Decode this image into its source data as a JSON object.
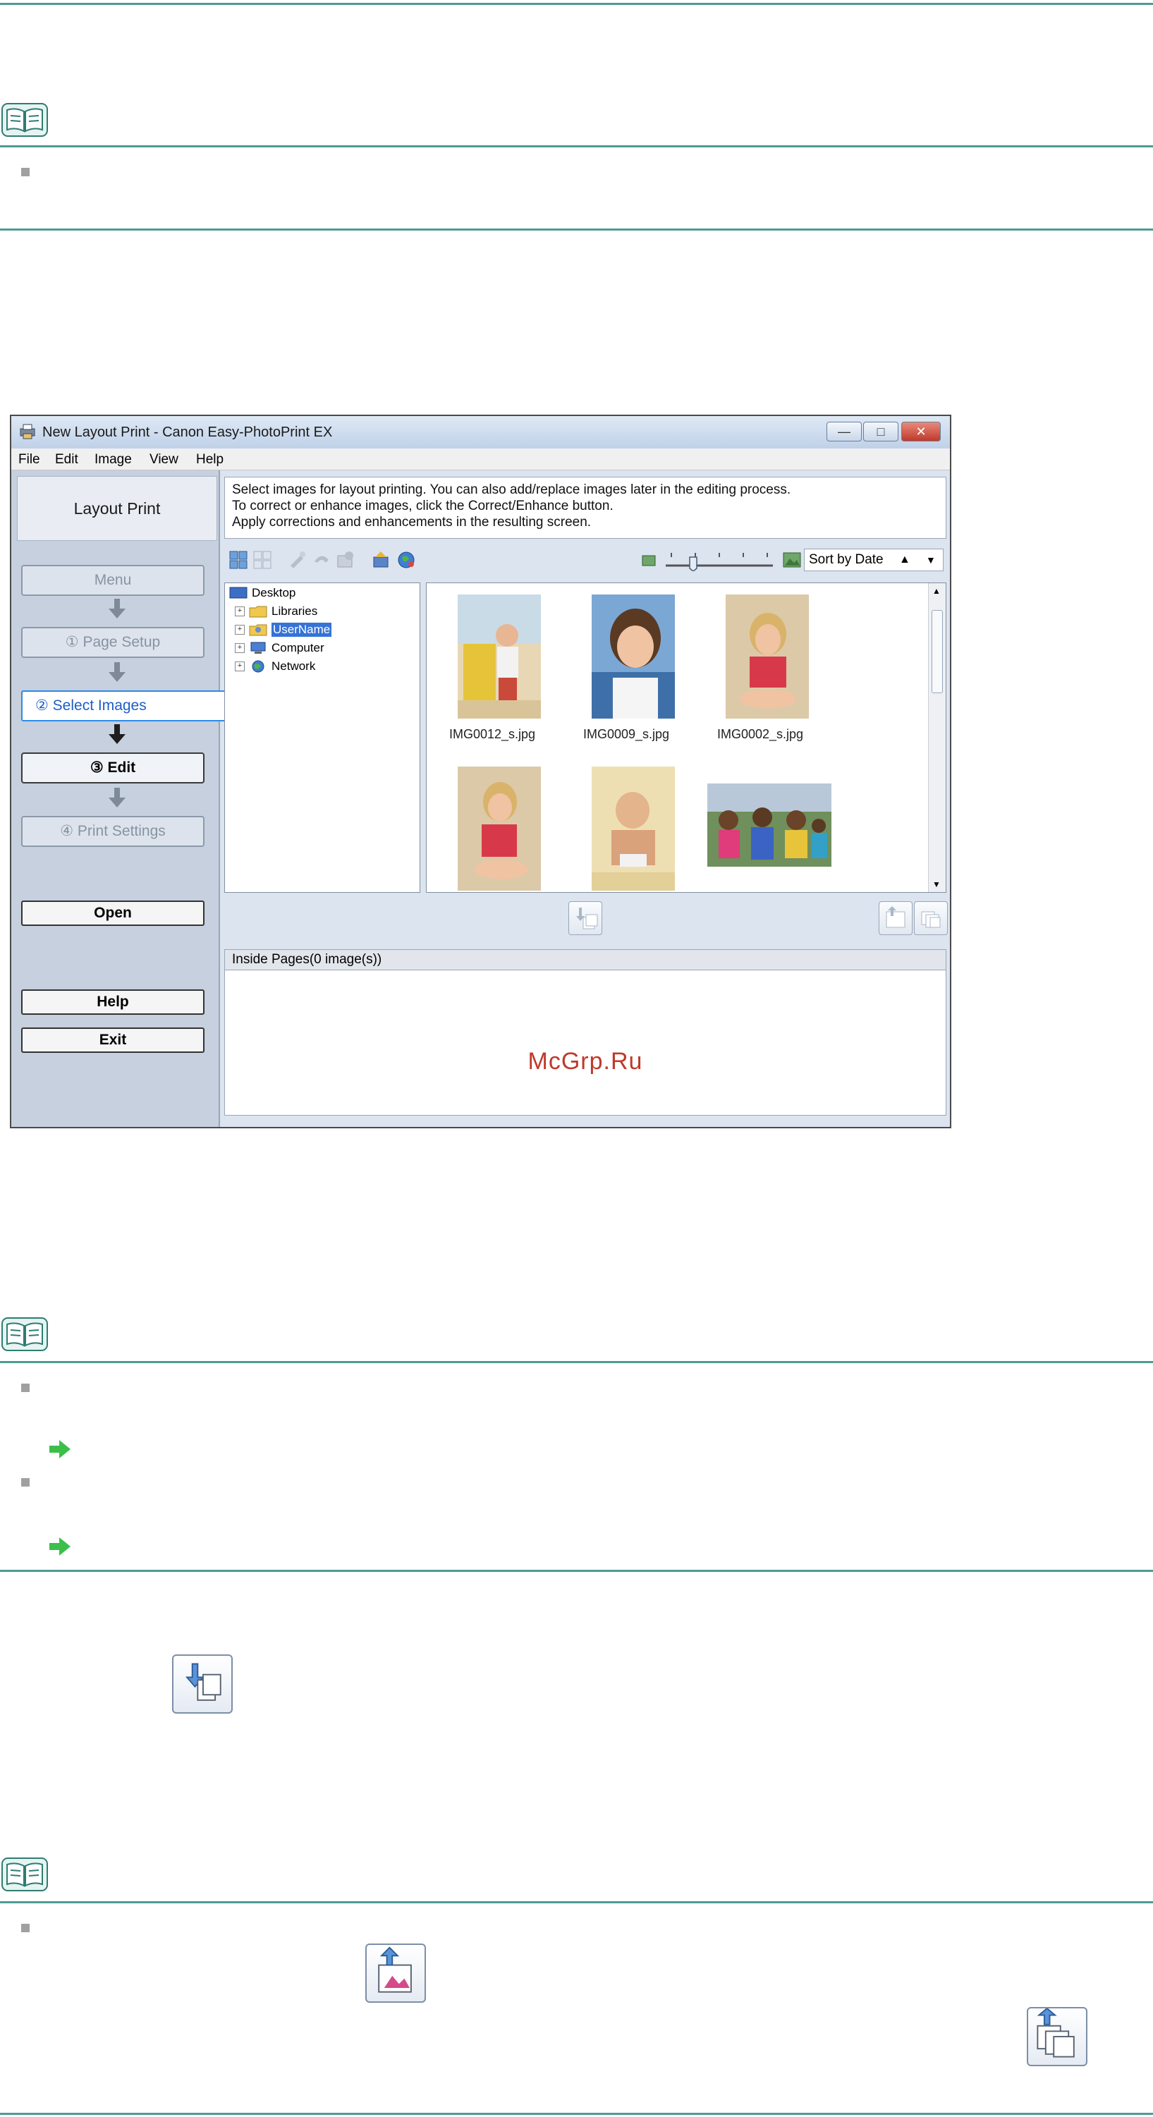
{
  "window": {
    "title": "New Layout Print - Canon Easy-PhotoPrint EX",
    "menu": [
      "File",
      "Edit",
      "Image",
      "View",
      "Help"
    ]
  },
  "left_panel": {
    "title": "Layout Print",
    "steps": [
      "Menu",
      "① Page Setup",
      "② Select Images",
      "③ Edit",
      "④ Print Settings"
    ],
    "open_label": "Open",
    "help_label": "Help",
    "exit_label": "Exit"
  },
  "instructions": [
    "Select images for layout printing. You can also add/replace images later in the editing process.",
    "To correct or enhance images, click the Correct/Enhance button.",
    "Apply corrections and enhancements in the resulting screen."
  ],
  "toolbar": {
    "sort_label": "Sort by Date"
  },
  "tree": {
    "root": "Desktop",
    "items": [
      "Libraries",
      "UserName",
      "Computer",
      "Network"
    ],
    "selected": "UserName"
  },
  "thumbnails": [
    "IMG0012_s.jpg",
    "IMG0009_s.jpg",
    "IMG0002_s.jpg"
  ],
  "inside_pages_label": "Inside Pages(0 image(s))",
  "watermark": "McGrp.Ru",
  "colors": {
    "rule": "#4f9a94",
    "accent_blue": "#2e8ae6",
    "watermark": "#c0392b",
    "link_arrow": "#3cbf4a"
  }
}
